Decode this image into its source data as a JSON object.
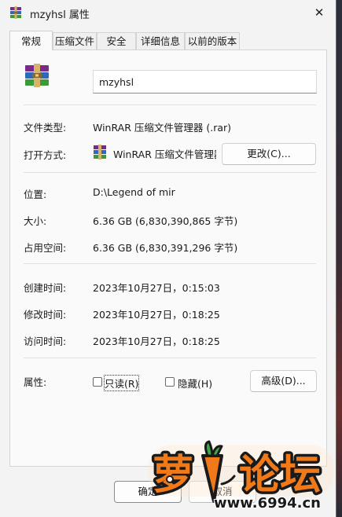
{
  "window": {
    "title": "mzyhsl 属性",
    "close_glyph": "✕"
  },
  "tabs": [
    {
      "label": "常规",
      "active": true
    },
    {
      "label": "压缩文件",
      "active": false
    },
    {
      "label": "安全",
      "active": false
    },
    {
      "label": "详细信息",
      "active": false
    },
    {
      "label": "以前的版本",
      "active": false
    }
  ],
  "general": {
    "file_name": "mzyhsl",
    "file_type_label": "文件类型:",
    "file_type_value": "WinRAR 压缩文件管理器 (.rar)",
    "open_with_label": "打开方式:",
    "open_with_value": "WinRAR 压缩文件管理器",
    "change_button": "更改(C)...",
    "location_label": "位置:",
    "location_value": "D:\\Legend of mir",
    "size_label": "大小:",
    "size_value": "6.36 GB (6,830,390,865 字节)",
    "size_on_disk_label": "占用空间:",
    "size_on_disk_value": "6.36 GB (6,830,391,296 字节)",
    "created_label": "创建时间:",
    "created_value": "2023年10月27日，0:15:03",
    "modified_label": "修改时间:",
    "modified_value": "2023年10月27日，0:18:25",
    "accessed_label": "访问时间:",
    "accessed_value": "2023年10月27日，0:18:25",
    "attributes_label": "属性:",
    "readonly_label": "只读(R)",
    "readonly_checked": false,
    "hidden_label": "隐藏(H)",
    "hidden_checked": false,
    "advanced_button": "高级(D)..."
  },
  "footer": {
    "ok_button": "确定",
    "cancel_button": "取消"
  },
  "watermark": {
    "main_text": "萝卜论坛",
    "sub_text": "www.6994.cn"
  },
  "icons": {
    "app": "winrar-archive-icon",
    "close": "close-icon",
    "checkbox": "checkbox-icon"
  },
  "colors": {
    "window_bg": "#f3f3f3",
    "panel_bg": "#fafafa",
    "watermark_orange": "#f07a1a"
  }
}
